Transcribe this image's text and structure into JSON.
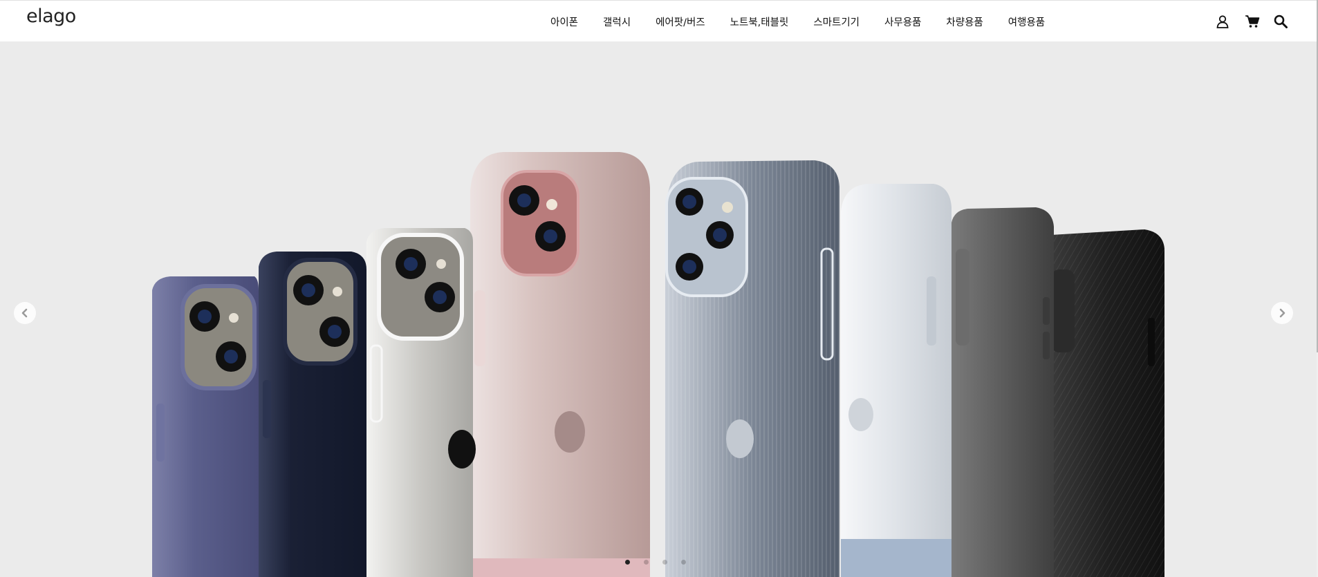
{
  "header": {
    "logo": "elago",
    "nav": [
      {
        "label": "아이폰"
      },
      {
        "label": "갤럭시"
      },
      {
        "label": "에어팟/버즈"
      },
      {
        "label": "노트북,태블릿"
      },
      {
        "label": "스마트기기"
      },
      {
        "label": "사무용품"
      },
      {
        "label": "차량용품"
      },
      {
        "label": "여행용품"
      }
    ],
    "icons": [
      "user-icon",
      "cart-icon",
      "search-icon"
    ]
  },
  "hero": {
    "background": "#ebebeb",
    "slide_count": 4,
    "active_slide": 1,
    "cases": [
      {
        "color": "#5b5f8c"
      },
      {
        "color": "#1a2035"
      },
      {
        "color": "#d8d8d6"
      },
      {
        "color": "#d9b8b4"
      },
      {
        "color": "#9aa3b0"
      },
      {
        "color": "#dfe3e8"
      },
      {
        "color": "#5c5c5c"
      },
      {
        "color": "#1f1f1f"
      }
    ]
  },
  "colors": {
    "accent": "#111111",
    "header_bg": "#ffffff"
  }
}
